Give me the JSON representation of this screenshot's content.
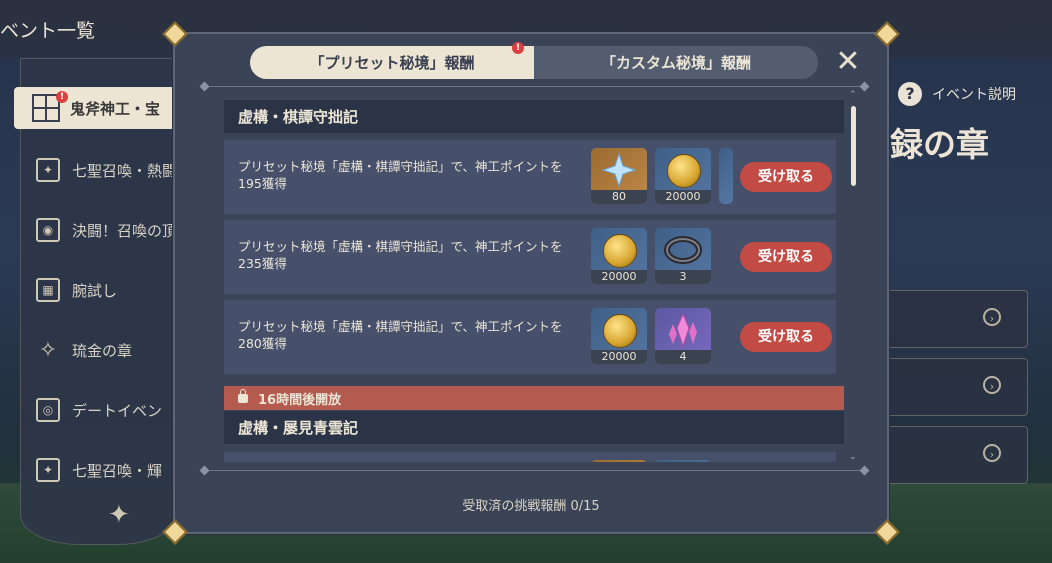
{
  "page_header": {
    "title": "ベント一覧"
  },
  "sidebar": {
    "active_item": {
      "label": "鬼斧神工・宝"
    },
    "items": [
      {
        "label": "七聖召喚・熱闘",
        "icon": "card-icon"
      },
      {
        "label": "決闘！召喚の頂",
        "icon": "shield-icon"
      },
      {
        "label": "腕試し",
        "icon": "cards-icon"
      },
      {
        "label": "琉金の章",
        "icon": "compass-icon"
      },
      {
        "label": "デートイベン",
        "icon": "eye-icon"
      },
      {
        "label": "七聖召喚・輝",
        "icon": "card-icon"
      }
    ]
  },
  "background_panel": {
    "help_label": "イベント説明",
    "title": "録の章"
  },
  "modal": {
    "tabs": [
      {
        "label": "「プリセット秘境」報酬",
        "active": true,
        "badge": "!"
      },
      {
        "label": "「カスタム秘境」報酬",
        "active": false
      }
    ],
    "sections": [
      {
        "title": "虚構・棋譚守拙記",
        "rows": [
          {
            "desc": "プリセット秘境「虚構・棋譚守拙記」で、神工ポイントを195獲得",
            "items": [
              {
                "icon": "primogem-icon",
                "count": "80"
              },
              {
                "icon": "mora-coin-icon",
                "count": "20000"
              }
            ],
            "button": "受け取る"
          },
          {
            "desc": "プリセット秘境「虚構・棋譚守拙記」で、神工ポイントを235獲得",
            "items": [
              {
                "icon": "mora-coin-icon",
                "count": "20000"
              },
              {
                "icon": "talent-material-icon",
                "count": "3"
              }
            ],
            "button": "受け取る"
          },
          {
            "desc": "プリセット秘境「虚構・棋譚守拙記」で、神工ポイントを280獲得",
            "items": [
              {
                "icon": "mora-coin-icon",
                "count": "20000"
              },
              {
                "icon": "crystal-icon",
                "count": "4"
              }
            ],
            "button": "受け取る"
          }
        ]
      },
      {
        "lock_label": "16時間後開放",
        "title": "虚構・屡見青雲記"
      }
    ],
    "footer": "受取済の挑戦報酬 0/15"
  }
}
